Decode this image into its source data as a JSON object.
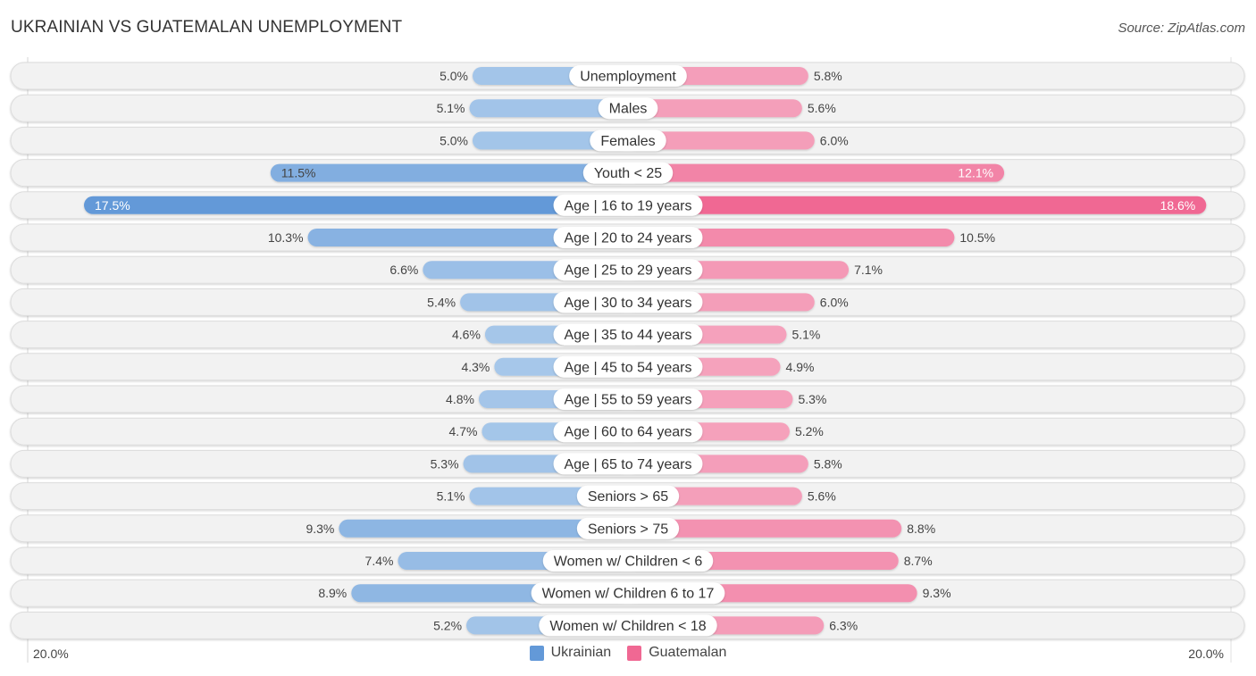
{
  "header": {
    "title": "UKRAINIAN VS GUATEMALAN UNEMPLOYMENT",
    "source": "Source: ZipAtlas.com"
  },
  "colors": {
    "ukrainian_light": "#a8c8ea",
    "ukrainian_strong": "#6399d8",
    "guatemalan_light": "#f5a6bf",
    "guatemalan_strong": "#f06893",
    "track": "#f2f2f2",
    "label_bg": "#ffffff"
  },
  "legend": {
    "items": [
      {
        "label": "Ukrainian",
        "color": "#6399d8"
      },
      {
        "label": "Guatemalan",
        "color": "#f06893"
      }
    ]
  },
  "axis": {
    "left_label": "20.0%",
    "right_label": "20.0%"
  },
  "chart_data": {
    "type": "bar",
    "orientation": "horizontal-diverging",
    "title": "UKRAINIAN VS GUATEMALAN UNEMPLOYMENT",
    "xlabel": "",
    "ylabel": "",
    "xlim": [
      0,
      20
    ],
    "grid": false,
    "legend_position": "bottom-center",
    "categories": [
      "Unemployment",
      "Males",
      "Females",
      "Youth < 25",
      "Age | 16 to 19 years",
      "Age | 20 to 24 years",
      "Age | 25 to 29 years",
      "Age | 30 to 34 years",
      "Age | 35 to 44 years",
      "Age | 45 to 54 years",
      "Age | 55 to 59 years",
      "Age | 60 to 64 years",
      "Age | 65 to 74 years",
      "Seniors > 65",
      "Seniors > 75",
      "Women w/ Children < 6",
      "Women w/ Children 6 to 17",
      "Women w/ Children < 18"
    ],
    "series": [
      {
        "name": "Ukrainian",
        "side": "left",
        "values": [
          5.0,
          5.1,
          5.0,
          11.5,
          17.5,
          10.3,
          6.6,
          5.4,
          4.6,
          4.3,
          4.8,
          4.7,
          5.3,
          5.1,
          9.3,
          7.4,
          8.9,
          5.2
        ],
        "labels": [
          "5.0%",
          "5.1%",
          "5.0%",
          "11.5%",
          "17.5%",
          "10.3%",
          "6.6%",
          "5.4%",
          "4.6%",
          "4.3%",
          "4.8%",
          "4.7%",
          "5.3%",
          "5.1%",
          "9.3%",
          "7.4%",
          "8.9%",
          "5.2%"
        ]
      },
      {
        "name": "Guatemalan",
        "side": "right",
        "values": [
          5.8,
          5.6,
          6.0,
          12.1,
          18.6,
          10.5,
          7.1,
          6.0,
          5.1,
          4.9,
          5.3,
          5.2,
          5.8,
          5.6,
          8.8,
          8.7,
          9.3,
          6.3
        ],
        "labels": [
          "5.8%",
          "5.6%",
          "6.0%",
          "12.1%",
          "18.6%",
          "10.5%",
          "7.1%",
          "6.0%",
          "5.1%",
          "4.9%",
          "5.3%",
          "5.2%",
          "5.8%",
          "5.6%",
          "8.8%",
          "8.7%",
          "9.3%",
          "6.3%"
        ]
      }
    ]
  }
}
